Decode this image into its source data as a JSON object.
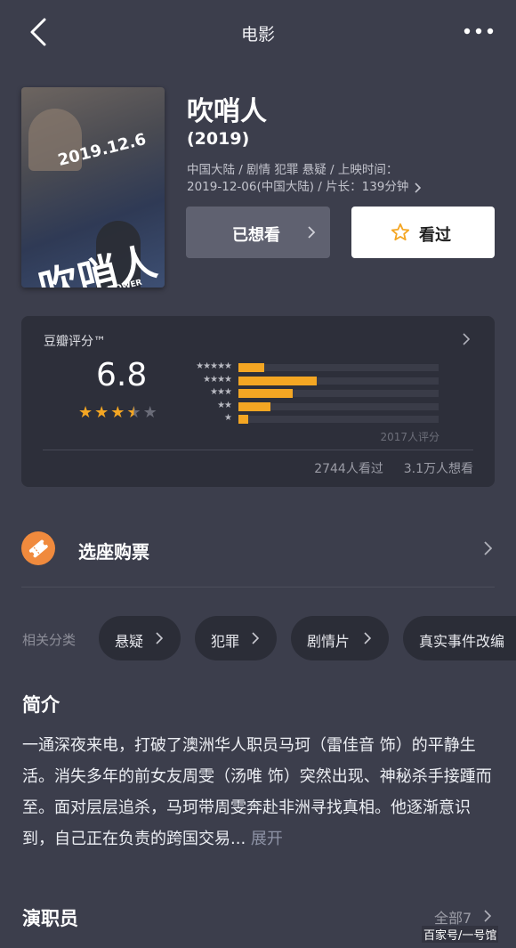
{
  "topbar": {
    "title": "电影"
  },
  "poster": {
    "date_text": "2019.12.6",
    "title_text": "吹哨人",
    "english_text": "THE WHISTLEBLOWER"
  },
  "movie": {
    "title": "吹哨人",
    "year": "(2019)",
    "meta_line1": "中国大陆 / 剧情 犯罪 悬疑 / 上映时间：",
    "meta_line2": "2019-12-06(中国大陆) / 片长：139分钟"
  },
  "actions": {
    "want_label": "已想看",
    "seen_label": "看过"
  },
  "rating": {
    "label": "豆瓣评分™",
    "score": "6.8",
    "stars_filled": 3.5,
    "distribution": [
      {
        "stars": "★★★★★",
        "fraction": 0.13
      },
      {
        "stars": "★★★★",
        "fraction": 0.39
      },
      {
        "stars": "★★★",
        "fraction": 0.27
      },
      {
        "stars": "★★",
        "fraction": 0.16
      },
      {
        "stars": "★",
        "fraction": 0.05
      }
    ],
    "count_text": "2017人评分",
    "seen_text": "2744人看过",
    "want_text": "3.1万人想看"
  },
  "ticket": {
    "label": "选座购票"
  },
  "categories": {
    "label": "相关分类",
    "items": [
      "悬疑",
      "犯罪",
      "剧情片",
      "真实事件改编"
    ]
  },
  "intro": {
    "title": "简介",
    "text": "一通深夜来电，打破了澳洲华人职员马珂（雷佳音 饰）的平静生活。消失多年的前女友周雯（汤唯 饰）突然出现、神秘杀手接踵而至。面对层层追杀，马珂带周雯奔赴非洲寻找真相。他逐渐意识到，自己正在负责的跨国交易...",
    "more_label": "展开"
  },
  "cast": {
    "title": "演职员",
    "all_label": "全部7"
  },
  "watermark": "百家号/一号馆",
  "colors": {
    "background": "#3c3e4c",
    "card": "#2d2f3a",
    "accent_star": "#f4a623",
    "ticket_orange": "#f08a3d"
  }
}
